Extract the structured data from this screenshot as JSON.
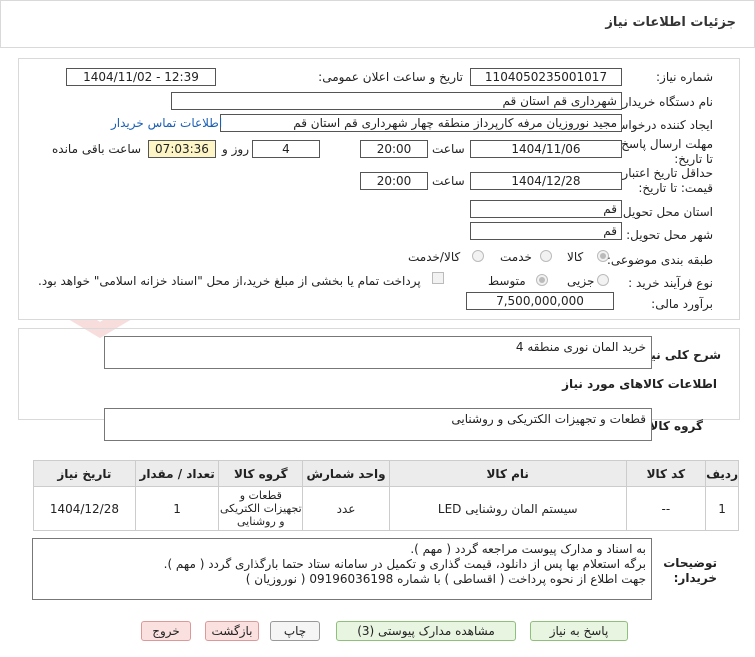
{
  "header": {
    "title": "جزئیات اطلاعات نیاز"
  },
  "form": {
    "need_number_label": "شماره نیاز:",
    "need_number": "1104050235001017",
    "announce_label": "تاریخ و ساعت اعلان عمومی:",
    "announce_value": "1404/11/02 - 12:39",
    "buyer_org_label": "نام دستگاه خریدار:",
    "buyer_org": "شهرداری قم استان قم",
    "requester_label": "ایجاد کننده درخواست:",
    "requester": "مجید نوروزیان مرفه کارپرداز منطقه چهار شهرداری قم استان قم",
    "contact_link": "اطلاعات تماس خریدار",
    "deadline_label": "مهلت ارسال پاسخ: تا تاریخ:",
    "deadline_date": "1404/11/06",
    "time_label": "ساعت",
    "deadline_time": "20:00",
    "days_value": "4",
    "days_label": "روز و",
    "remaining_time": "07:03:36",
    "remaining_label": "ساعت باقی مانده",
    "validity_label": "حداقل تاریخ اعتبار قیمت: تا تاریخ:",
    "validity_date": "1404/12/28",
    "validity_time": "20:00",
    "province_label": "استان محل تحویل:",
    "province": "قم",
    "city_label": "شهر محل تحویل:",
    "city": "قم",
    "category_label": "طبقه بندی موضوعی:",
    "category_options": [
      "کالا",
      "خدمت",
      "کالا/خدمت"
    ],
    "category_selected": "کالا",
    "process_label": "نوع فرآیند خرید :",
    "process_options": [
      "جزیی",
      "متوسط"
    ],
    "process_selected": "متوسط",
    "payment_note": "پرداخت تمام یا بخشی از مبلغ خرید،از محل \"اسناد خزانه اسلامی\" خواهد بود.",
    "estimate_label": "برآورد مالی:",
    "estimate_value": "7,500,000,000"
  },
  "watermark": {
    "text": "AriaTender.net"
  },
  "summary": {
    "label": "شرح کلی نیاز:",
    "value": "خرید المان نوری منطقه 4"
  },
  "goods_section": {
    "title": "اطلاعات کالاهای مورد نیاز",
    "group_label": "گروه کالا:",
    "group_value": "قطعات و تجهیزات الکتریکی و روشنایی"
  },
  "table": {
    "headers": [
      "ردیف",
      "کد کالا",
      "نام کالا",
      "واحد شمارش",
      "گروه کالا",
      "تعداد / مقدار",
      "تاریخ نیاز"
    ],
    "rows": [
      [
        "1",
        "--",
        "سیستم المان روشنایی LED",
        "عدد",
        "قطعات و تجهیزات الکتریکی و روشنایی",
        "1",
        "1404/12/28"
      ]
    ]
  },
  "notes": {
    "label": "توضیحات خریدار:",
    "lines": [
      "به اسناد و مدارک پیوست مراجعه گردد ( مهم ).",
      "برگه استعلام بها پس از دانلود، قیمت گذاری و تکمیل در سامانه ستاد حتما بارگذاری گردد ( مهم ).",
      "جهت اطلاع از نحوه پرداخت ( اقساطی ) با شماره 09196036198 ( نوروزیان )"
    ]
  },
  "buttons": {
    "reply": "پاسخ به نیاز",
    "attachments": "مشاهده مدارک پیوستی (3)",
    "print": "چاپ",
    "back": "بازگشت",
    "exit": "خروج"
  },
  "colors": {
    "link": "#1a5fb4",
    "remaining_bg": "#fdf5c6",
    "header_bg": "#ececec"
  }
}
